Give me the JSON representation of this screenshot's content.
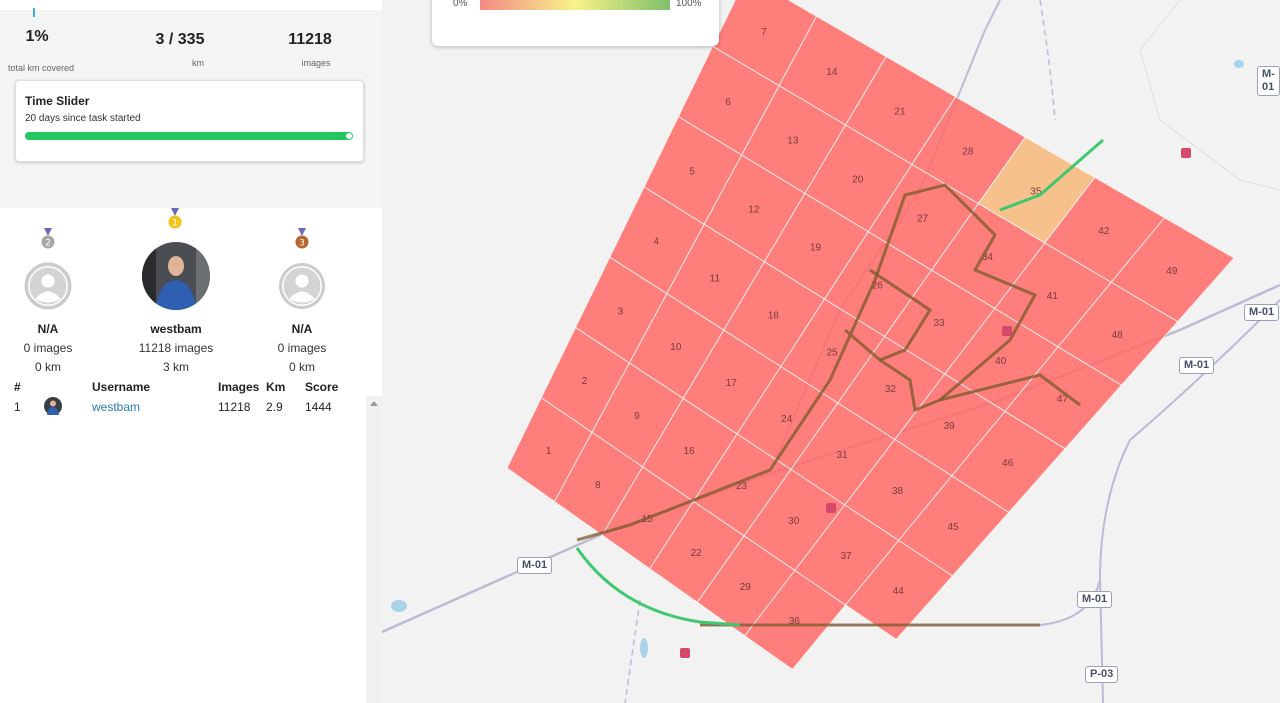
{
  "stats": {
    "covered_pct": "1%",
    "covered_label": "total km covered",
    "km_value": "3 / 335",
    "km_label": "km",
    "images_value": "11218",
    "images_label": "images"
  },
  "time_slider": {
    "title": "Time Slider",
    "subtitle": "20 days since task started",
    "progress": 1.0
  },
  "podium": [
    {
      "rank": "2",
      "name": "N/A",
      "images": "0 images",
      "km": "0 km",
      "medal_color": "#a8a8a8"
    },
    {
      "rank": "1",
      "name": "westbam",
      "images": "11218 images",
      "km": "3 km",
      "medal_color": "#f0c419"
    },
    {
      "rank": "3",
      "name": "N/A",
      "images": "0 images",
      "km": "0 km",
      "medal_color": "#b8652d"
    }
  ],
  "leaderboard": {
    "headers": {
      "rank": "#",
      "username": "Username",
      "images": "Images",
      "km": "Km",
      "score": "Score"
    },
    "rows": [
      {
        "rank": "1",
        "username": "westbam",
        "images": "11218",
        "km": "2.9",
        "score": "1444"
      }
    ]
  },
  "legend": {
    "min": "0%",
    "max": "100%"
  },
  "grid": {
    "cell_color_uncovered": "#ff6a66",
    "cell_color_partial": "#f7b87a",
    "cells": [
      "1",
      "2",
      "3",
      "4",
      "5",
      "6",
      "7",
      "8",
      "9",
      "10",
      "11",
      "12",
      "13",
      "14",
      "15",
      "16",
      "17",
      "18",
      "19",
      "20",
      "21",
      "22",
      "23",
      "24",
      "25",
      "26",
      "27",
      "28",
      "29",
      "30",
      "31",
      "32",
      "33",
      "34",
      "35",
      "36",
      "37",
      "38",
      "39",
      "40",
      "41",
      "42",
      "44",
      "45",
      "46",
      "47",
      "48",
      "49"
    ],
    "partial_cell": "35"
  },
  "road_labels": [
    "M-01",
    "M-01",
    "M-01",
    "M-01",
    "M-01",
    "P-03"
  ]
}
